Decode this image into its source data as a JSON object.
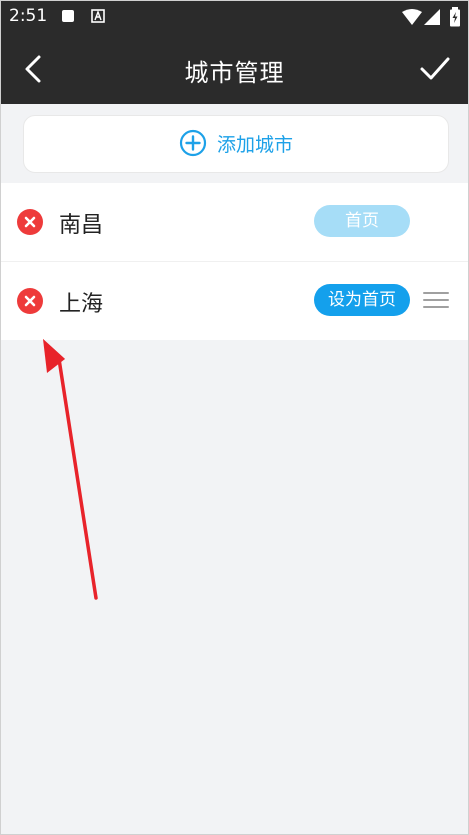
{
  "status_bar": {
    "time": "2:51",
    "icons": [
      "square-icon",
      "a-box-icon",
      "wifi-icon",
      "signal-icon",
      "battery-icon"
    ]
  },
  "app_bar": {
    "title": "城市管理",
    "back_icon": "chevron-left-icon",
    "confirm_icon": "check-icon"
  },
  "add_city": {
    "label": "添加城市",
    "icon": "plus-circle-icon",
    "color": "#1da1e8"
  },
  "cities": [
    {
      "name": "南昌",
      "action": "首页",
      "is_home": true
    },
    {
      "name": "上海",
      "action": "设为首页",
      "is_home": false
    }
  ],
  "colors": {
    "bar": "#2b2b2b",
    "accent": "#14a0ec",
    "home_badge": "#a6ddf7",
    "remove": "#ee3b3b",
    "annotation_arrow": "#e8232a"
  }
}
